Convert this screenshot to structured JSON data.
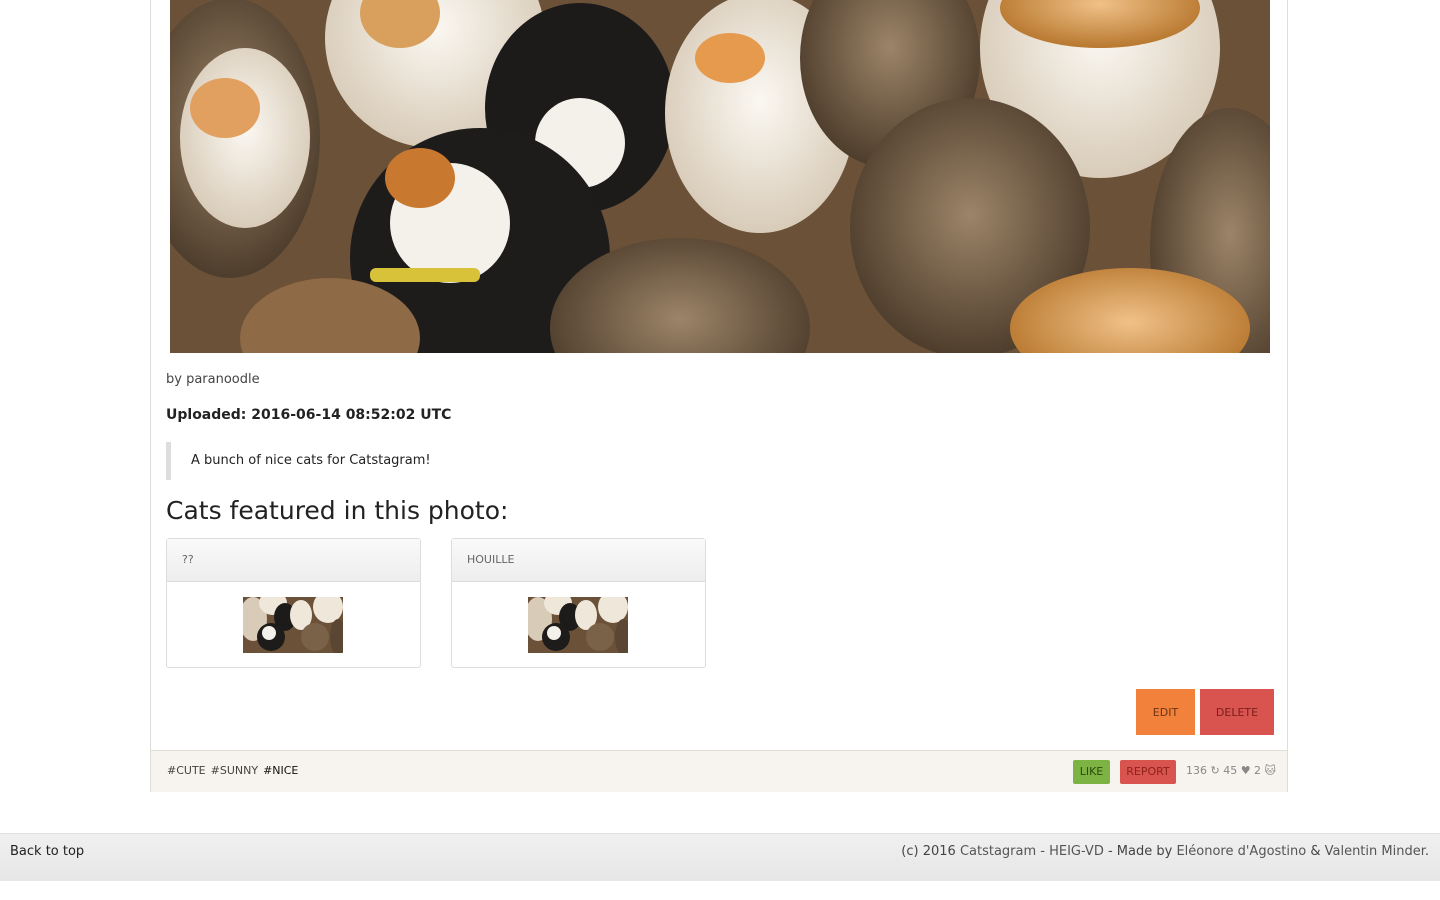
{
  "post": {
    "byline": "by paranoodle",
    "uploaded": "Uploaded: 2016-06-14 08:52:02 UTC",
    "description": "A bunch of nice cats for Catstagram!",
    "cats_heading": "Cats featured in this photo:",
    "cats": [
      {
        "name": "??"
      },
      {
        "name": "HOUILLE"
      }
    ],
    "edit_label": "EDIT",
    "delete_label": "DELETE"
  },
  "footer_bar": {
    "tags": [
      "#CUTE",
      "#SUNNY",
      "#NICE"
    ],
    "like_label": "LIKE",
    "report_label": "REPORT",
    "stats": "136 ↻ 45 ♥ 2 🐱"
  },
  "page_footer": {
    "back_to_top": "Back to top",
    "credit_prefix": "(c) 2016 ",
    "credit_site": "Catstagram - HEIG-VD",
    "credit_mid": " - Made by ",
    "author1": "Eléonore d'Agostino",
    "credit_and": " & ",
    "author2": "Valentin Minder",
    "credit_end": "."
  },
  "colors": {
    "edit": "#f2813b",
    "delete": "#d9534f",
    "like": "#7cb342",
    "report": "#d9534f"
  }
}
